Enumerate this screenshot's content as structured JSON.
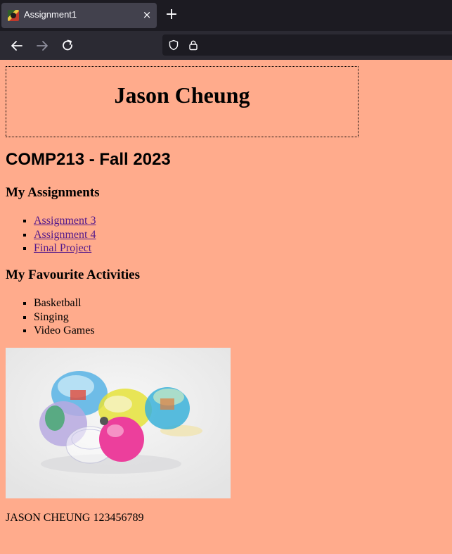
{
  "browser": {
    "tab_title": "Assignment1",
    "tab_close": "×",
    "new_tab": "+",
    "icons": [
      "favicon",
      "close-icon",
      "plus-icon",
      "back-arrow-icon",
      "forward-arrow-icon",
      "reload-icon",
      "shield-icon",
      "lock-icon"
    ]
  },
  "page": {
    "name_heading": "Jason Cheung",
    "course_title": "COMP213 - Fall 2023",
    "assignments_heading": "My Assignments",
    "assignments": [
      {
        "label": "Assignment 3"
      },
      {
        "label": "Assignment 4"
      },
      {
        "label": "Final Project"
      }
    ],
    "activities_heading": "My Favourite Activities",
    "activities": [
      {
        "label": "Basketball"
      },
      {
        "label": "Singing"
      },
      {
        "label": "Video Games"
      }
    ],
    "image_subject": "capsule toys photo",
    "footer": "JASON CHEUNG 123456789"
  },
  "colors": {
    "page_background": "#ffab8c",
    "link": "#551a8b",
    "tabbar": "#1c1b22",
    "navbar": "#2b2a33"
  }
}
